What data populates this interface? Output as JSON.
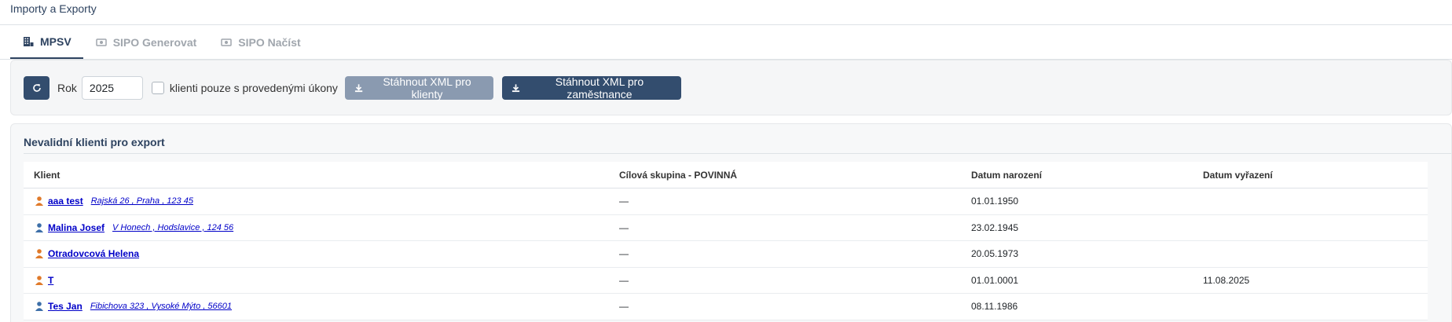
{
  "page": {
    "title": "Importy a Exporty"
  },
  "tabs": [
    {
      "label": "MPSV",
      "icon": "building-icon",
      "active": true
    },
    {
      "label": "SIPO Generovat",
      "icon": "money-icon",
      "active": false
    },
    {
      "label": "SIPO Načíst",
      "icon": "money-icon",
      "active": false
    }
  ],
  "toolbar": {
    "refresh_icon": "refresh-icon",
    "year_label": "Rok",
    "year_value": "2025",
    "checkbox_label": "klienti pouze s provedenými úkony",
    "checkbox_checked": false,
    "download_clients_label": "Stáhnout XML pro klienty",
    "download_staff_label": "Stáhnout XML pro zaměstnance"
  },
  "invalid_clients": {
    "title": "Nevalidní klienti pro export",
    "columns": [
      "Klient",
      "Cílová skupina - POVINNÁ",
      "Datum narození",
      "Datum vyřazení"
    ],
    "rows": [
      {
        "gender": "female",
        "name": "aaa test",
        "address": "Rajská 26 , Praha , 123 45",
        "group": "—",
        "birth": "01.01.1950",
        "removed": ""
      },
      {
        "gender": "male",
        "name": "Malina Josef",
        "address": "V Honech , Hodslavice , 124 56",
        "group": "—",
        "birth": "23.02.1945",
        "removed": ""
      },
      {
        "gender": "female",
        "name": "Otradovcová Helena",
        "address": "",
        "group": "—",
        "birth": "20.05.1973",
        "removed": ""
      },
      {
        "gender": "female",
        "name": "T",
        "address": "",
        "group": "—",
        "birth": "01.01.0001",
        "removed": "11.08.2025"
      },
      {
        "gender": "male",
        "name": "Tes Jan",
        "address": "Fibichova 323 , Vysoké Mýto , 56601",
        "group": "—",
        "birth": "08.11.1986",
        "removed": ""
      }
    ]
  },
  "colors": {
    "primary": "#334d6e",
    "disabled": "#8a9ab0",
    "link": "#0000c8",
    "female_icon": "#e07a2a",
    "male_icon": "#3d6fa8"
  }
}
